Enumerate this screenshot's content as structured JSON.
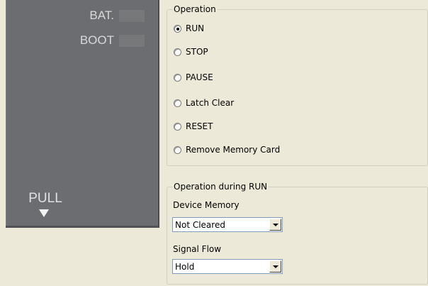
{
  "device": {
    "leds": [
      {
        "label": "BAT."
      },
      {
        "label": "BOOT"
      }
    ],
    "pull_label": "PULL"
  },
  "operation": {
    "title": "Operation",
    "options": [
      {
        "label": "RUN",
        "selected": true
      },
      {
        "label": "STOP",
        "selected": false
      },
      {
        "label": "PAUSE",
        "selected": false
      },
      {
        "label": "Latch Clear",
        "selected": false
      },
      {
        "label": "RESET",
        "selected": false
      },
      {
        "label": "Remove Memory Card",
        "selected": false
      }
    ]
  },
  "operation_during_run": {
    "title": "Operation during RUN",
    "device_memory": {
      "label": "Device Memory",
      "value": "Not Cleared"
    },
    "signal_flow": {
      "label": "Signal Flow",
      "value": "Hold"
    }
  }
}
